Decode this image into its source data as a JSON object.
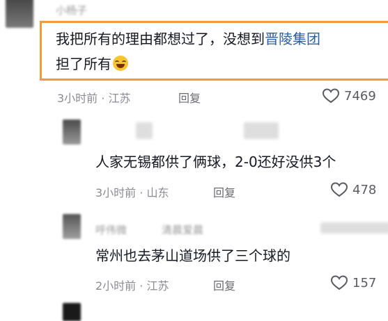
{
  "comments": [
    {
      "user": "小杨子",
      "text_line1_plain": "我把所有的理由都想过了，没想到",
      "text_line1_link": "晋陵集团",
      "text_line2": "担了所有",
      "emoji": "laughing-crying-face",
      "time": "3小时前",
      "location": "江苏",
      "reply_label": "回复",
      "likes": "7469"
    },
    {
      "text": "人家无锡都供了俩球，2-0还好没供3个",
      "time": "3小时前",
      "location": "山东",
      "reply_label": "回复",
      "likes": "478"
    },
    {
      "user": "呼伟微",
      "reply_to": "清晨爱晨",
      "text": "常州也去茅山道场供了三个球的",
      "time": "2小时前",
      "location": "江苏",
      "reply_label": "回复",
      "likes": "157"
    }
  ],
  "separator": "·",
  "colors": {
    "highlight_border": "#f39a3f",
    "link": "#2b5fa8",
    "meta": "#8a8b91"
  },
  "icons": {
    "like": "heart-outline-icon"
  }
}
